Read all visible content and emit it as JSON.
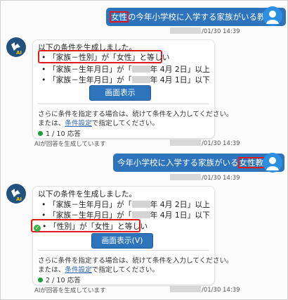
{
  "messages": [
    {
      "user_text_pre": "",
      "user_text_highlight": "女性",
      "user_text_post": "の今年小学校に入学する家族がいる教職員",
      "user_time": "/01/30 14:39",
      "bot": {
        "intro": "以下の条件を生成しました。",
        "conditions": [
          {
            "text": "「家族－性別」が「女性」と等しい"
          },
          {
            "pre": "「家族－生年月日」が「",
            "post": "年 4月 2日」以上"
          },
          {
            "pre": "「家族－生年月日」が「",
            "post": "年 4月 1日」以下"
          }
        ],
        "button_label": "画面表示",
        "hint_line1": "さらに条件を指定する場合は、続けて条件を入力してください。",
        "hint_line2_pre": "または、",
        "hint_link": "条件設定",
        "hint_line2_post": "で指定してください。",
        "count": "1 / 10 応答",
        "footer_note": "AIが回答を生成しています",
        "bot_time": "/01/30 14:39"
      }
    },
    {
      "user_text_pre": "今年小学校に入学する家族がいる",
      "user_text_highlight": "女性教職員",
      "user_text_post": "",
      "user_time": "/01/30 14:39",
      "bot": {
        "intro": "以下の条件を生成しました。",
        "conditions": [
          {
            "pre": "「家族－生年月日」が「",
            "post": "年 4月 2日」以上"
          },
          {
            "pre": "「家族－生年月日」が「",
            "post": "年 4月 1日」以下"
          },
          {
            "text": "「性別」が「女性」と等しい"
          }
        ],
        "button_label": "画面表示(V)",
        "hint_line1": "さらに条件を指定する場合は、続けて条件を入力してください。",
        "hint_line2_pre": "または、",
        "hint_link": "条件設定",
        "hint_line2_post": "で指定してください。",
        "count": "2 / 10 応答",
        "footer_note": "AIが回答を生成しています",
        "bot_time": "/01/30 14:39"
      }
    }
  ],
  "icons": {
    "user_avatar": "person-icon",
    "bot_avatar": "ai-assistant-icon",
    "check": "check-icon",
    "status_dot": "status-dot-icon"
  },
  "colors": {
    "user_bubble": "#2d74bd",
    "highlight_border": "#e01b1b",
    "status_green": "#1e9b3c",
    "link": "#2b63b0"
  }
}
